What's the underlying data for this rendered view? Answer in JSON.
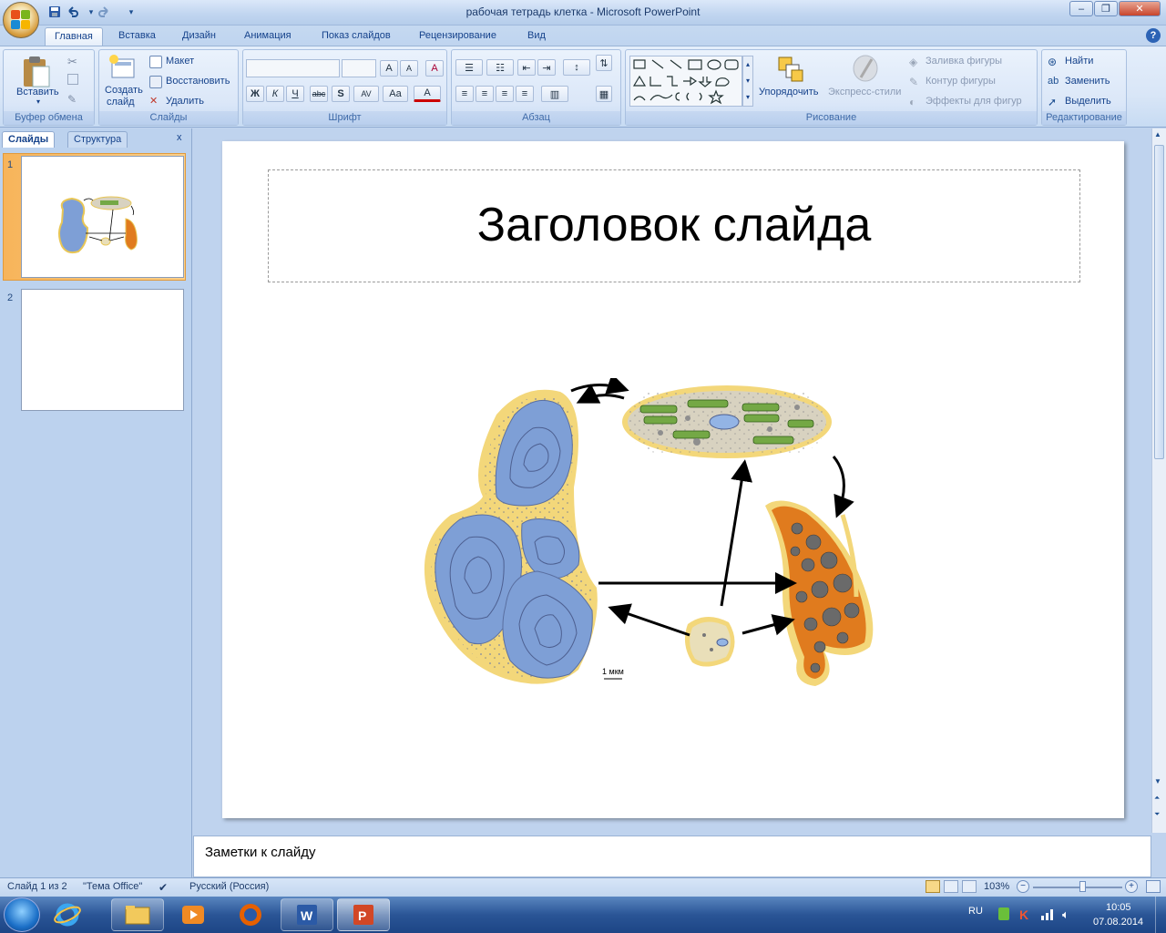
{
  "window": {
    "title": "рабочая тетрадь клетка - Microsoft PowerPoint",
    "controls": {
      "minimize": "–",
      "restore": "❐",
      "close": "✕"
    }
  },
  "quick_access": {
    "save_icon": "save-icon",
    "undo_icon": "undo-icon",
    "redo_icon": "redo-icon",
    "customize": "▾"
  },
  "tabs": [
    "Главная",
    "Вставка",
    "Дизайн",
    "Анимация",
    "Показ слайдов",
    "Рецензирование",
    "Вид"
  ],
  "help": "?",
  "ribbon": {
    "clipboard": {
      "label": "Буфер обмена",
      "paste": "Вставить"
    },
    "slides": {
      "label": "Слайды",
      "new_slide_1": "Создать",
      "new_slide_2": "слайд",
      "layout": "Макет",
      "reset": "Восстановить",
      "delete": "Удалить"
    },
    "font": {
      "label": "Шрифт",
      "font_name": "",
      "font_size": "",
      "grow": "A",
      "shrink": "A",
      "clear": "A",
      "bold": "Ж",
      "italic": "К",
      "underline": "Ч",
      "strike": "abc",
      "shadow": "S",
      "spacing": "AV",
      "case": "Aa",
      "color": "A"
    },
    "paragraph": {
      "label": "Абзац"
    },
    "drawing": {
      "label": "Рисование",
      "arrange": "Упорядочить",
      "quick_styles": "Экспресс-стили",
      "fill": "Заливка фигуры",
      "outline": "Контур фигуры",
      "effects": "Эффекты для фигур"
    },
    "editing": {
      "label": "Редактирование",
      "find": "Найти",
      "replace": "Заменить",
      "select": "Выделить"
    }
  },
  "left_pane": {
    "tab_slides": "Слайды",
    "tab_outline": "Структура",
    "close": "x",
    "slide_numbers": [
      "1",
      "2"
    ]
  },
  "slide": {
    "title": "Заголовок слайда",
    "scale_label": "1 мкм"
  },
  "notes": {
    "placeholder": "Заметки к слайду"
  },
  "status": {
    "slide_count": "Слайд 1 из 2",
    "theme": "\"Тема Office\"",
    "language": "Русский (Россия)",
    "zoom": "103%",
    "zoom_fraction": 0.55
  },
  "taskbar": {
    "lang": "RU",
    "time": "10:05",
    "date": "07.08.2014"
  },
  "colors": {
    "ribbon_bg": "#dbe7f8",
    "tab_active": "#ffffff",
    "cell_blue": "#7e9fd6",
    "cell_yellow": "#f3d77a",
    "cell_green": "#74a845",
    "cell_orange": "#e07b1e"
  }
}
